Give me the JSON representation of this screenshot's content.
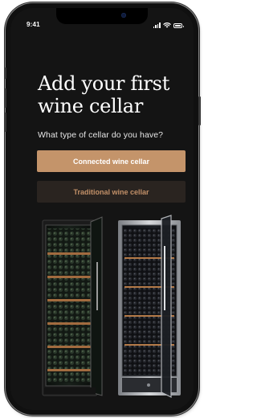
{
  "status_bar": {
    "time": "9:41"
  },
  "onboarding": {
    "title_line1": "Add your first",
    "title_line2": "wine cellar",
    "question": "What type of cellar do you have?",
    "connected_button_label": "Connected wine cellar",
    "traditional_button_label": "Traditional wine cellar"
  },
  "colors": {
    "background": "#141414",
    "accent": "#c4946a",
    "secondary_button_bg": "#2a2420",
    "secondary_button_text": "#c29068"
  },
  "icons": [
    "cellular-signal-icon",
    "wifi-icon",
    "battery-icon"
  ]
}
